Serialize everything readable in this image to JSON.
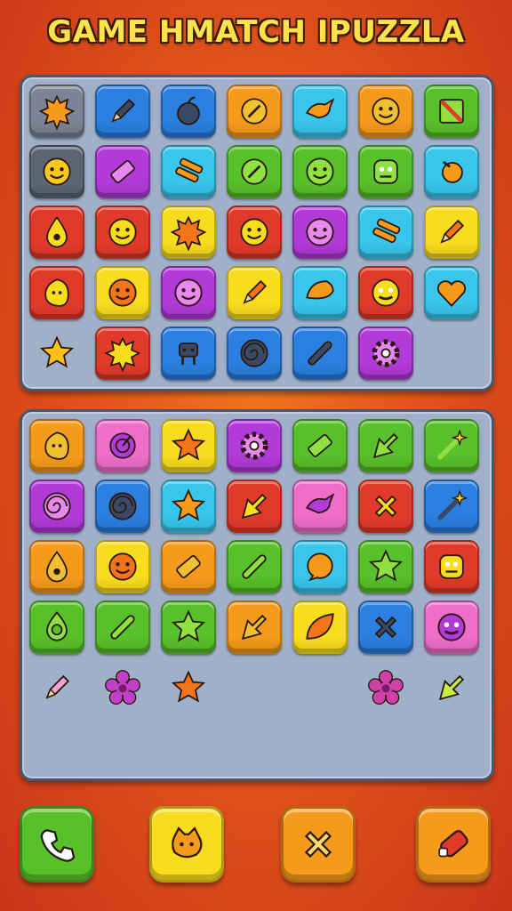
{
  "title": "GAME HMATCH IPUZZLA",
  "colors": {
    "gray": "#7b8494",
    "blue": "#2b7fe0",
    "red": "#e23a2a",
    "orange": "#f59a1a",
    "cyan": "#39c6ec",
    "yellow": "#f9dc1e",
    "green": "#58c02a",
    "purple": "#b23ad8",
    "pink": "#ee6ec8",
    "darkgray": "#5d6474"
  },
  "top_board": {
    "tiles": [
      {
        "bg": "gray",
        "icon": "splat-icon"
      },
      {
        "bg": "blue",
        "icon": "pencil-icon"
      },
      {
        "bg": "blue",
        "icon": "apple-icon"
      },
      {
        "bg": "orange",
        "icon": "ball-icon"
      },
      {
        "bg": "cyan",
        "icon": "bird-icon"
      },
      {
        "bg": "orange",
        "icon": "smiley-icon"
      },
      {
        "bg": "green",
        "icon": "flag-icon"
      },
      {
        "bg": "darkgray",
        "icon": "smiley-icon"
      },
      {
        "bg": "purple",
        "icon": "ticket-icon"
      },
      {
        "bg": "cyan",
        "icon": "stack-icon"
      },
      {
        "bg": "green",
        "icon": "ball-icon"
      },
      {
        "bg": "green",
        "icon": "smiley-icon"
      },
      {
        "bg": "green",
        "icon": "monster-icon"
      },
      {
        "bg": "cyan",
        "icon": "bulb-icon"
      },
      {
        "bg": "red",
        "icon": "drop-icon"
      },
      {
        "bg": "red",
        "icon": "smiley-icon"
      },
      {
        "bg": "yellow",
        "icon": "splat-icon"
      },
      {
        "bg": "red",
        "icon": "smiley-icon"
      },
      {
        "bg": "purple",
        "icon": "smiley-icon"
      },
      {
        "bg": "cyan",
        "icon": "stack-icon"
      },
      {
        "bg": "yellow",
        "icon": "pencil-icon"
      },
      {
        "bg": "red",
        "icon": "blob-icon"
      },
      {
        "bg": "yellow",
        "icon": "smiley-icon"
      },
      {
        "bg": "purple",
        "icon": "smiley-icon"
      },
      {
        "bg": "yellow",
        "icon": "pencil-icon"
      },
      {
        "bg": "cyan",
        "icon": "shell-icon"
      },
      {
        "bg": "red",
        "icon": "face-icon"
      },
      {
        "bg": "cyan",
        "icon": "heart-icon"
      },
      {
        "bg": "none",
        "icon": "star-icon"
      },
      {
        "bg": "red",
        "icon": "splat-icon"
      },
      {
        "bg": "blue",
        "icon": "robot-icon"
      },
      {
        "bg": "blue",
        "icon": "spiral-icon"
      },
      {
        "bg": "blue",
        "icon": "slash-icon"
      },
      {
        "bg": "purple",
        "icon": "gear-icon"
      },
      {
        "bg": "none",
        "icon": ""
      }
    ]
  },
  "bottom_board": {
    "tiles": [
      {
        "bg": "orange",
        "icon": "blob-icon"
      },
      {
        "bg": "pink",
        "icon": "target-icon"
      },
      {
        "bg": "yellow",
        "icon": "star-icon"
      },
      {
        "bg": "purple",
        "icon": "gear-icon"
      },
      {
        "bg": "green",
        "icon": "ticket-icon"
      },
      {
        "bg": "green",
        "icon": "arrow-icon"
      },
      {
        "bg": "green",
        "icon": "wand-icon"
      },
      {
        "bg": "purple",
        "icon": "spiral-icon"
      },
      {
        "bg": "blue",
        "icon": "spiral-icon"
      },
      {
        "bg": "cyan",
        "icon": "star-icon"
      },
      {
        "bg": "red",
        "icon": "arrow-icon"
      },
      {
        "bg": "pink",
        "icon": "bird-icon"
      },
      {
        "bg": "red",
        "icon": "cross-icon"
      },
      {
        "bg": "blue",
        "icon": "wand-icon"
      },
      {
        "bg": "orange",
        "icon": "drop-icon"
      },
      {
        "bg": "yellow",
        "icon": "smiley-icon"
      },
      {
        "bg": "orange",
        "icon": "ticket-icon"
      },
      {
        "bg": "green",
        "icon": "slash-icon"
      },
      {
        "bg": "cyan",
        "icon": "bubble-icon"
      },
      {
        "bg": "green",
        "icon": "star-icon"
      },
      {
        "bg": "red",
        "icon": "monster-icon"
      },
      {
        "bg": "green",
        "icon": "ring-icon"
      },
      {
        "bg": "green",
        "icon": "slash-icon"
      },
      {
        "bg": "green",
        "icon": "star-icon"
      },
      {
        "bg": "orange",
        "icon": "arrow-icon"
      },
      {
        "bg": "yellow",
        "icon": "leaf-icon"
      },
      {
        "bg": "blue",
        "icon": "cross-icon"
      },
      {
        "bg": "pink",
        "icon": "face-icon"
      },
      {
        "bg": "none",
        "icon": "pencil-icon"
      },
      {
        "bg": "none",
        "icon": "flower-icon"
      },
      {
        "bg": "none",
        "icon": "star-icon"
      },
      {
        "bg": "none",
        "icon": ""
      },
      {
        "bg": "none",
        "icon": ""
      },
      {
        "bg": "none",
        "icon": "flower-icon"
      },
      {
        "bg": "none",
        "icon": "arrow-icon"
      }
    ]
  },
  "buttons": [
    {
      "name": "phone-button",
      "bg": "green",
      "icon": "phone-icon"
    },
    {
      "name": "pet-button",
      "bg": "yellow",
      "icon": "cat-icon"
    },
    {
      "name": "close-button",
      "bg": "orange",
      "icon": "cross-icon"
    },
    {
      "name": "eraser-button",
      "bg": "orange",
      "icon": "eraser-icon"
    }
  ]
}
